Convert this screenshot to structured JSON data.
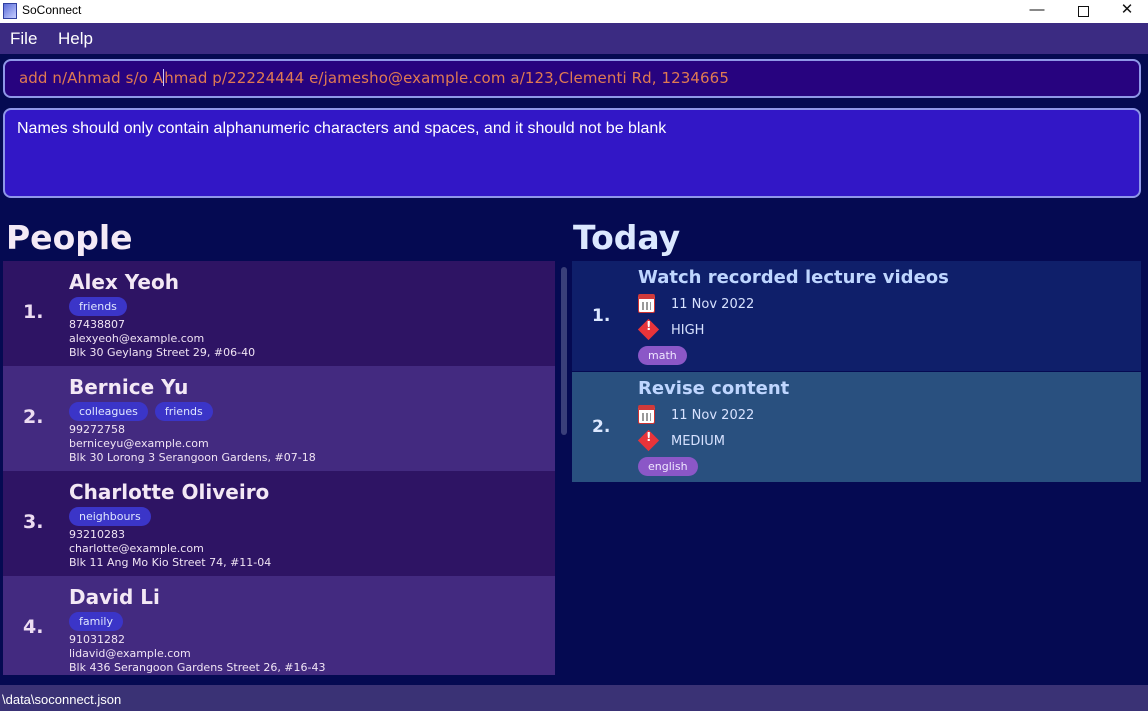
{
  "window": {
    "title": "SoConnect",
    "min_glyph": "—",
    "close_glyph": "✕"
  },
  "menu": {
    "file": "File",
    "help": "Help"
  },
  "command": {
    "value_before_caret": "add n/Ahmad s/o A",
    "value_after_caret": "hmad p/22224444 e/jamesho@example.com a/123,Clementi Rd, 1234665"
  },
  "result": {
    "message": "Names should only contain alphanumeric characters and spaces, and it should not be blank"
  },
  "people_panel": {
    "heading": "People",
    "items": [
      {
        "index": "1.",
        "name": "Alex Yeoh",
        "tags": [
          "friends"
        ],
        "phone": "87438807",
        "email": "alexyeoh@example.com",
        "address": "Blk 30 Geylang Street 29, #06-40"
      },
      {
        "index": "2.",
        "name": "Bernice Yu",
        "tags": [
          "colleagues",
          "friends"
        ],
        "phone": "99272758",
        "email": "berniceyu@example.com",
        "address": "Blk 30 Lorong 3 Serangoon Gardens, #07-18"
      },
      {
        "index": "3.",
        "name": "Charlotte Oliveiro",
        "tags": [
          "neighbours"
        ],
        "phone": "93210283",
        "email": "charlotte@example.com",
        "address": "Blk 11 Ang Mo Kio Street 74, #11-04"
      },
      {
        "index": "4.",
        "name": "David Li",
        "tags": [
          "family"
        ],
        "phone": "91031282",
        "email": "lidavid@example.com",
        "address": "Blk 436 Serangoon Gardens Street 26, #16-43"
      }
    ]
  },
  "today_panel": {
    "heading": "Today",
    "items": [
      {
        "index": "1.",
        "title": "Watch recorded lecture videos",
        "date": "11 Nov 2022",
        "priority": "HIGH",
        "tag": "math"
      },
      {
        "index": "2.",
        "title": "Revise content",
        "date": "11 Nov 2022",
        "priority": "MEDIUM",
        "tag": "english"
      }
    ]
  },
  "status": {
    "path": "\\data\\soconnect.json"
  },
  "icons": {
    "date": "calendar-icon",
    "priority": "priority-icon",
    "priority_mark": "!"
  },
  "colors": {
    "background": "#050a52",
    "menu": "#3b2b82",
    "command_text": "#e07a52",
    "result_bg": "#3217c6",
    "tag": "#3b35c8",
    "task_tag": "#8b57c7",
    "priority": "#e8343a"
  }
}
